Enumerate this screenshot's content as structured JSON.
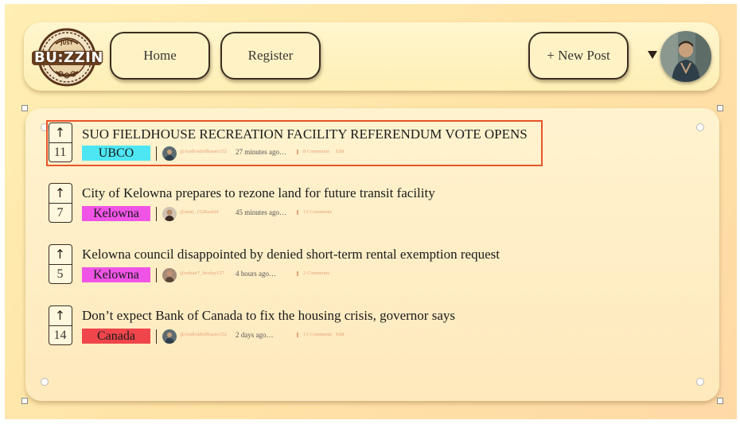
{
  "header": {
    "logo_text": "BU:ZZIN",
    "logo_small": "JUST",
    "nav": {
      "home": "Home",
      "register": "Register",
      "new_post": "+ New Post"
    }
  },
  "posts": [
    {
      "votes": "11",
      "title": "SUO FIELDHOUSE RECREATION FACILITY REFERENDUM VOTE OPENS",
      "tag": "UBCO",
      "tag_color": "#4de6f2",
      "author": "@Androidoffbases152",
      "time": "27 minutes ago…",
      "comments": "8 Comments",
      "edit": "Edit"
    },
    {
      "votes": "7",
      "title": "City of Kelowna prepares to rezone land for future transit facility",
      "tag": "Kelowna",
      "tag_color": "#f054e6",
      "author": "@amit_152Rashid",
      "time": "45 minutes ago…",
      "comments": "13 Comments",
      "edit": ""
    },
    {
      "votes": "5",
      "title": "Kelowna council disappointed by denied short-term rental exemption request",
      "tag": "Kelowna",
      "tag_color": "#f054e6",
      "author": "@zubair7_bexley127",
      "time": "4 hours ago…",
      "comments": "2 Comments",
      "edit": ""
    },
    {
      "votes": "14",
      "title": "Don’t expect Bank of Canada to fix the housing crisis, governor says",
      "tag": "Canada",
      "tag_color": "#f0454b",
      "author": "@Androidoffbases152",
      "time": "2 days ago…",
      "comments": "13 Comments",
      "edit": "Edit"
    }
  ]
}
